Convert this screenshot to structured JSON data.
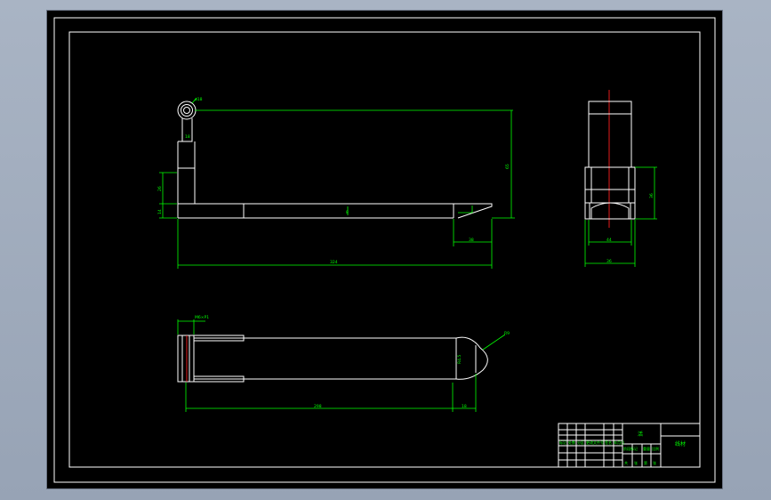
{
  "drawing": {
    "colors": {
      "background": "#000000",
      "outline": "#ffffff",
      "dimension": "#00ff00",
      "centerline": "#ff2020",
      "viewport": "#97a3b5"
    },
    "dimensions": {
      "front_height": "65",
      "front_length": "324",
      "front_tip": "38",
      "front_left_step": "26",
      "front_left_small": "14",
      "front_hole": "ø18",
      "front_slot": "18",
      "front_mid": "8",
      "side_height": "36",
      "side_inner": "44",
      "side_width": "36",
      "top_length": "298",
      "top_tip": "18",
      "top_radius": "R9",
      "top_thread": "M6×P1",
      "top_chamfer": "R4.5"
    },
    "title_block": {
      "part_name": "活",
      "material": "线材",
      "row_labels": [
        "标记",
        "处数",
        "分区",
        "更改文件号",
        "签名",
        "年月日"
      ],
      "mid_labels": [
        "阶段标记",
        "重量",
        "比例"
      ],
      "bottom_labels": [
        "共",
        "张",
        "第",
        "张"
      ]
    }
  }
}
